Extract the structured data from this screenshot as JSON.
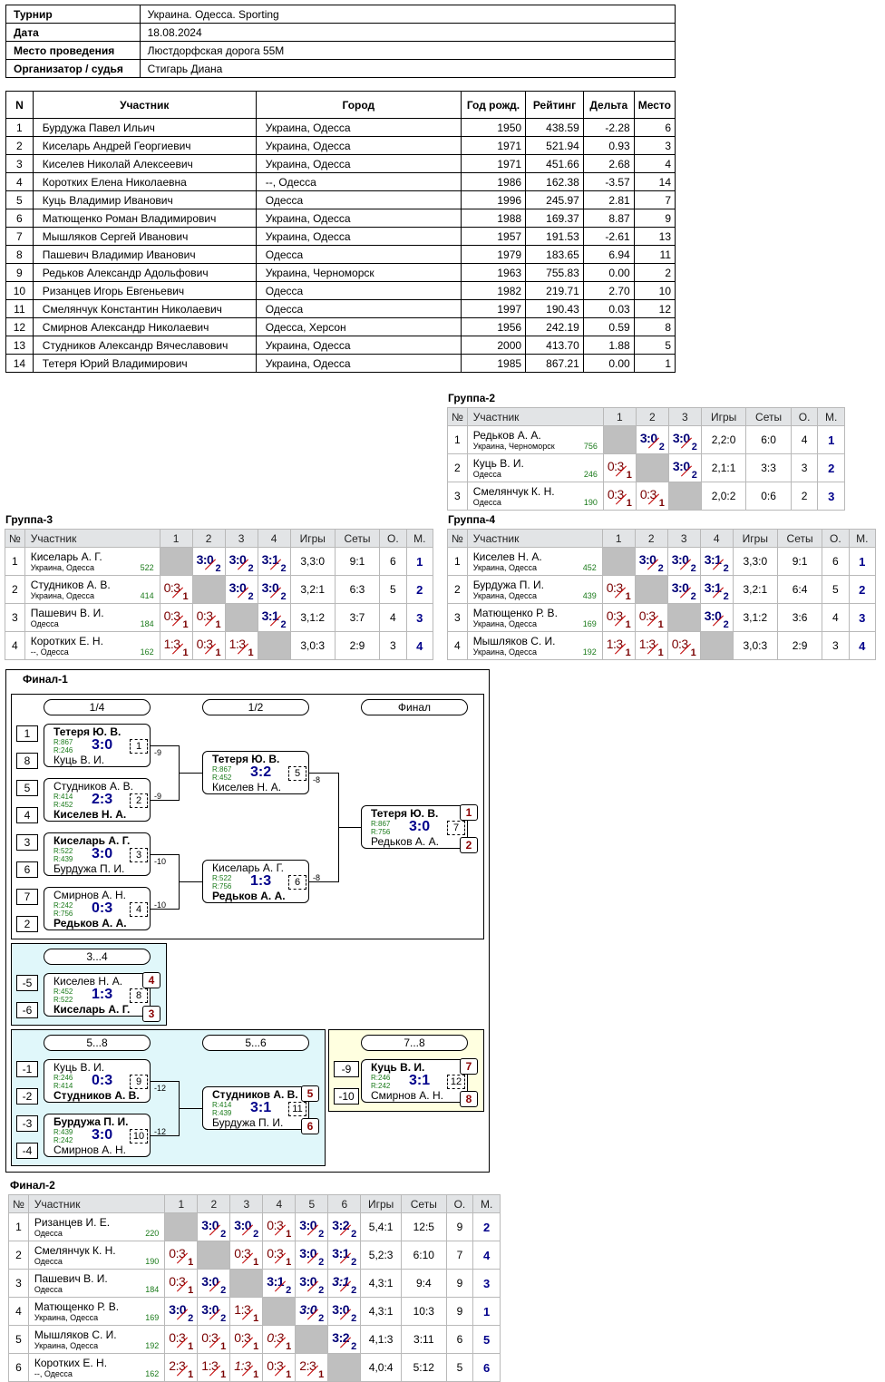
{
  "info": [
    [
      "Турнир",
      "Украина. Одесса. Sporting"
    ],
    [
      "Дата",
      "18.08.2024"
    ],
    [
      "Место проведения",
      "Люстдорфская дорога 55М"
    ],
    [
      "Организатор / судья",
      "Стигарь Диана"
    ]
  ],
  "players_header": [
    "N",
    "Участник",
    "Город",
    "Год рожд.",
    "Рейтинг",
    "Дельта",
    "Место"
  ],
  "players": [
    [
      "1",
      "Бурдужа Павел Ильич",
      "Украина, Одесса",
      "1950",
      "438.59",
      "-2.28",
      "6"
    ],
    [
      "2",
      "Киселарь Андрей Георгиевич",
      "Украина, Одесса",
      "1971",
      "521.94",
      "0.93",
      "3"
    ],
    [
      "3",
      "Киселев Николай Алексеевич",
      "Украина, Одесса",
      "1971",
      "451.66",
      "2.68",
      "4"
    ],
    [
      "4",
      "Коротких Елена Николаевна",
      "--, Одесса",
      "1986",
      "162.38",
      "-3.57",
      "14"
    ],
    [
      "5",
      "Куць Владимир Иванович",
      "Одесса",
      "1996",
      "245.97",
      "2.81",
      "7"
    ],
    [
      "6",
      "Матющенко Роман Владимирович",
      "Украина, Одесса",
      "1988",
      "169.37",
      "8.87",
      "9"
    ],
    [
      "7",
      "Мышляков Сергей Иванович",
      "Украина, Одесса",
      "1957",
      "191.53",
      "-2.61",
      "13"
    ],
    [
      "8",
      "Пашевич Владимир Иванович",
      "Одесса",
      "1979",
      "183.65",
      "6.94",
      "11"
    ],
    [
      "9",
      "Редьков Александр Адольфович",
      "Украина, Черноморск",
      "1963",
      "755.83",
      "0.00",
      "2"
    ],
    [
      "10",
      "Ризанцев Игорь Евгеньевич",
      "Одесса",
      "1982",
      "219.71",
      "2.70",
      "10"
    ],
    [
      "11",
      "Смелянчук Константин Николаевич",
      "Одесса",
      "1997",
      "190.43",
      "0.03",
      "12"
    ],
    [
      "12",
      "Смирнов Александр Николаевич",
      "Одесса, Херсон",
      "1956",
      "242.19",
      "0.59",
      "8"
    ],
    [
      "13",
      "Студников Александр Вячеславович",
      "Украина, Одесса",
      "2000",
      "413.70",
      "1.88",
      "5"
    ],
    [
      "14",
      "Тетеря Юрий Владимирович",
      "Украина, Одесса",
      "1985",
      "867.21",
      "0.00",
      "1"
    ]
  ],
  "groups": [
    {
      "title": "Группа-2",
      "header": [
        "№",
        "Участник",
        "1",
        "2",
        "3",
        "Игры",
        "Сеты",
        "О.",
        "М."
      ],
      "rows": [
        {
          "n": "1",
          "name": "Редьков А. А.",
          "city": "Украина, Черноморск",
          "rating": "756",
          "cells": [
            "X",
            "w:3:0:2",
            "w:3:0:2"
          ],
          "games": "2,2:0",
          "sets": "6:0",
          "pts": "4",
          "place": "1"
        },
        {
          "n": "2",
          "name": "Куць В. И.",
          "city": "Одесса",
          "rating": "246",
          "cells": [
            "l:0:3:1",
            "X",
            "w:3:0:2"
          ],
          "games": "2,1:1",
          "sets": "3:3",
          "pts": "3",
          "place": "2"
        },
        {
          "n": "3",
          "name": "Смелянчук К. Н.",
          "city": "Одесса",
          "rating": "190",
          "cells": [
            "l:0:3:1",
            "l:0:3:1",
            "X"
          ],
          "games": "2,0:2",
          "sets": "0:6",
          "pts": "2",
          "place": "3"
        }
      ]
    },
    {
      "title": "Группа-3",
      "header": [
        "№",
        "Участник",
        "1",
        "2",
        "3",
        "4",
        "Игры",
        "Сеты",
        "О.",
        "М."
      ],
      "rows": [
        {
          "n": "1",
          "name": "Киселарь А. Г.",
          "city": "Украина, Одесса",
          "rating": "522",
          "cells": [
            "X",
            "w:3:0:2",
            "w:3:0:2",
            "w:3:1:2"
          ],
          "games": "3,3:0",
          "sets": "9:1",
          "pts": "6",
          "place": "1"
        },
        {
          "n": "2",
          "name": "Студников А. В.",
          "city": "Украина, Одесса",
          "rating": "414",
          "cells": [
            "l:0:3:1",
            "X",
            "w:3:0:2",
            "w:3:0:2"
          ],
          "games": "3,2:1",
          "sets": "6:3",
          "pts": "5",
          "place": "2"
        },
        {
          "n": "3",
          "name": "Пашевич В. И.",
          "city": "Одесса",
          "rating": "184",
          "cells": [
            "l:0:3:1",
            "l:0:3:1",
            "X",
            "w:3:1:2"
          ],
          "games": "3,1:2",
          "sets": "3:7",
          "pts": "4",
          "place": "3"
        },
        {
          "n": "4",
          "name": "Коротких Е. Н.",
          "city": "--, Одесса",
          "rating": "162",
          "cells": [
            "l:1:3:1",
            "l:0:3:1",
            "l:1:3:1",
            "X"
          ],
          "games": "3,0:3",
          "sets": "2:9",
          "pts": "3",
          "place": "4"
        }
      ]
    },
    {
      "title": "Группа-4",
      "header": [
        "№",
        "Участник",
        "1",
        "2",
        "3",
        "4",
        "Игры",
        "Сеты",
        "О.",
        "М."
      ],
      "rows": [
        {
          "n": "1",
          "name": "Киселев Н. А.",
          "city": "Украина, Одесса",
          "rating": "452",
          "cells": [
            "X",
            "w:3:0:2",
            "w:3:0:2",
            "w:3:1:2"
          ],
          "games": "3,3:0",
          "sets": "9:1",
          "pts": "6",
          "place": "1"
        },
        {
          "n": "2",
          "name": "Бурдужа П. И.",
          "city": "Украина, Одесса",
          "rating": "439",
          "cells": [
            "l:0:3:1",
            "X",
            "w:3:0:2",
            "w:3:1:2"
          ],
          "games": "3,2:1",
          "sets": "6:4",
          "pts": "5",
          "place": "2"
        },
        {
          "n": "3",
          "name": "Матющенко Р. В.",
          "city": "Украина, Одесса",
          "rating": "169",
          "cells": [
            "l:0:3:1",
            "l:0:3:1",
            "X",
            "w:3:0:2"
          ],
          "games": "3,1:2",
          "sets": "3:6",
          "pts": "4",
          "place": "3"
        },
        {
          "n": "4",
          "name": "Мышляков С. И.",
          "city": "Украина, Одесса",
          "rating": "192",
          "cells": [
            "l:1:3:1",
            "l:1:3:1",
            "l:0:3:1",
            "X"
          ],
          "games": "3,0:3",
          "sets": "2:9",
          "pts": "3",
          "place": "4"
        }
      ]
    },
    {
      "title": "Финал-2",
      "header": [
        "№",
        "Участник",
        "1",
        "2",
        "3",
        "4",
        "5",
        "6",
        "Игры",
        "Сеты",
        "О.",
        "М."
      ],
      "rows": [
        {
          "n": "1",
          "name": "Ризанцев И. Е.",
          "city": "Одесса",
          "rating": "220",
          "cells": [
            "X",
            "w:3:0:2",
            "w:3:0:2",
            "l:0:3:1",
            "w:3:0:2",
            "w:3:2:2"
          ],
          "games": "5,4:1",
          "sets": "12:5",
          "pts": "9",
          "place": "2"
        },
        {
          "n": "2",
          "name": "Смелянчук К. Н.",
          "city": "Одесса",
          "rating": "190",
          "cells": [
            "l:0:3:1",
            "X",
            "l:0:3:1",
            "l:0:3:1",
            "w:3:0:2",
            "w:3:1:2"
          ],
          "games": "5,2:3",
          "sets": "6:10",
          "pts": "7",
          "place": "4"
        },
        {
          "n": "3",
          "name": "Пашевич В. И.",
          "city": "Одесса",
          "rating": "184",
          "cells": [
            "l:0:3:1",
            "w:3:0:2",
            "X",
            "w:3:1:2",
            "w:3:0:2",
            "wi:3:1:2"
          ],
          "games": "4,3:1",
          "sets": "9:4",
          "pts": "9",
          "place": "3"
        },
        {
          "n": "4",
          "name": "Матющенко Р. В.",
          "city": "Украина, Одесса",
          "rating": "169",
          "cells": [
            "w:3:0:2",
            "w:3:0:2",
            "l:1:3:1",
            "X",
            "wi:3:0:2",
            "w:3:0:2"
          ],
          "games": "4,3:1",
          "sets": "10:3",
          "pts": "9",
          "place": "1"
        },
        {
          "n": "5",
          "name": "Мышляков С. И.",
          "city": "Украина, Одесса",
          "rating": "192",
          "cells": [
            "l:0:3:1",
            "l:0:3:1",
            "l:0:3:1",
            "li:0:3:1",
            "X",
            "w:3:2:2"
          ],
          "games": "4,1:3",
          "sets": "3:11",
          "pts": "6",
          "place": "5"
        },
        {
          "n": "6",
          "name": "Коротких Е. Н.",
          "city": "--, Одесса",
          "rating": "162",
          "cells": [
            "l:2:3:1",
            "l:1:3:1",
            "li:1:3:1",
            "l:0:3:1",
            "l:2:3:1",
            "X"
          ],
          "games": "4,0:4",
          "sets": "5:12",
          "pts": "5",
          "place": "6"
        }
      ]
    }
  ],
  "final1": {
    "title": "Финал-1",
    "headers": [
      "1/4",
      "1/2",
      "Финал",
      "3...4",
      "5...8",
      "5...6",
      "7...8"
    ],
    "seeds": [
      "1",
      "8",
      "5",
      "4",
      "3",
      "6",
      "7",
      "2",
      "-5",
      "-6",
      "-1",
      "-2",
      "-3",
      "-4",
      "-9",
      "-10"
    ],
    "labels": [
      "-9",
      "-9",
      "-10",
      "-10",
      "-8",
      "-8",
      "-12",
      "-12"
    ],
    "places": [
      "1",
      "2",
      "4",
      "3",
      "5",
      "6",
      "7",
      "8"
    ],
    "matches": [
      {
        "a": "Тетеря Ю. В.",
        "ra": "R:867",
        "rb": "R:246",
        "b": "Куць В. И.",
        "score": "3:0",
        "num": "1",
        "win": "a"
      },
      {
        "a": "Студников А. В.",
        "ra": "R:414",
        "rb": "R:452",
        "b": "Киселев Н. А.",
        "score": "2:3",
        "num": "2",
        "win": "b"
      },
      {
        "a": "Киселарь А. Г.",
        "ra": "R:522",
        "rb": "R:439",
        "b": "Бурдужа П. И.",
        "score": "3:0",
        "num": "3",
        "win": "a"
      },
      {
        "a": "Смирнов А. Н.",
        "ra": "R:242",
        "rb": "R:756",
        "b": "Редьков А. А.",
        "score": "0:3",
        "num": "4",
        "win": "b"
      },
      {
        "a": "Тетеря Ю. В.",
        "ra": "R:867",
        "rb": "R:452",
        "b": "Киселев Н. А.",
        "score": "3:2",
        "num": "5",
        "win": "a"
      },
      {
        "a": "Киселарь А. Г.",
        "ra": "R:522",
        "rb": "R:756",
        "b": "Редьков А. А.",
        "score": "1:3",
        "num": "6",
        "win": "b"
      },
      {
        "a": "Тетеря Ю. В.",
        "ra": "R:867",
        "rb": "R:756",
        "b": "Редьков А. А.",
        "score": "3:0",
        "num": "7",
        "win": "a"
      },
      {
        "a": "Киселев Н. А.",
        "ra": "R:452",
        "rb": "R:522",
        "b": "Киселарь А. Г.",
        "score": "1:3",
        "num": "8",
        "win": "b"
      },
      {
        "a": "Куць В. И.",
        "ra": "R:246",
        "rb": "R:414",
        "b": "Студников А. В.",
        "score": "0:3",
        "num": "9",
        "win": "b"
      },
      {
        "a": "Бурдужа П. И.",
        "ra": "R:439",
        "rb": "R:242",
        "b": "Смирнов А. Н.",
        "score": "3:0",
        "num": "10",
        "win": "a"
      },
      {
        "a": "Студников А. В.",
        "ra": "R:414",
        "rb": "R:439",
        "b": "Бурдужа П. И.",
        "score": "3:1",
        "num": "11",
        "win": "a"
      },
      {
        "a": "Куць В. И.",
        "ra": "R:246",
        "rb": "R:242",
        "b": "Смирнов А. Н.",
        "score": "3:1",
        "num": "12",
        "win": "a"
      }
    ]
  },
  "colors": {
    "win": "#000077",
    "loss": "#7a0000",
    "rating": "#1a7a1a",
    "header_bg": "#e2e4e6",
    "self_cell": "#bfbfbf",
    "box34": "#e0f7fa",
    "box58": "#e0f7fa",
    "box78": "#ffffe0"
  }
}
